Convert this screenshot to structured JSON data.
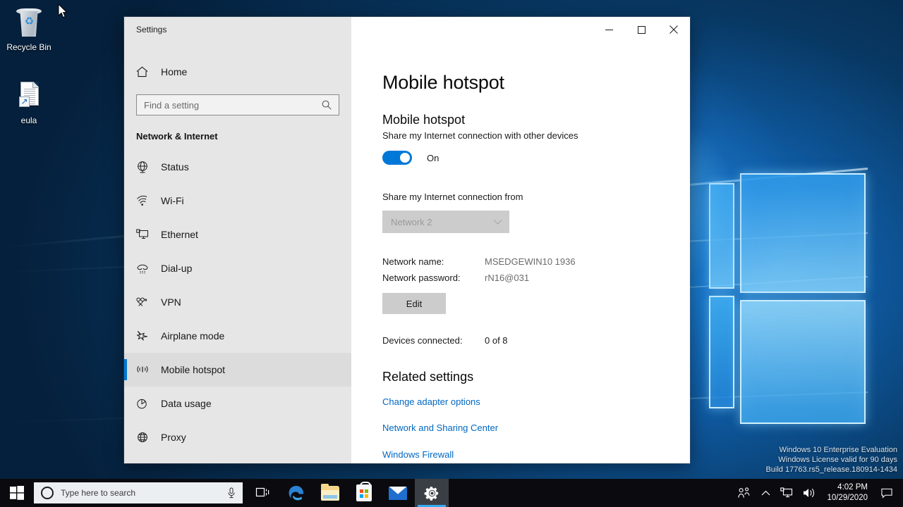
{
  "desktop": {
    "icons": [
      {
        "name": "Recycle Bin",
        "icon": "recycle-bin-icon"
      },
      {
        "name": "eula",
        "icon": "text-document-shortcut-icon"
      }
    ],
    "watermark": {
      "line1": "Windows 10 Enterprise Evaluation",
      "line2": "Windows License valid for 90 days",
      "line3": "Build 17763.rs5_release.180914-1434"
    }
  },
  "window": {
    "title": "Settings",
    "controls": {
      "minimize": "Minimize",
      "maximize": "Maximize",
      "close": "Close"
    }
  },
  "sidebar": {
    "home_label": "Home",
    "search": {
      "placeholder": "Find a setting",
      "value": ""
    },
    "group_title": "Network & Internet",
    "items": [
      {
        "label": "Status",
        "icon": "globe-status-icon",
        "selected": false
      },
      {
        "label": "Wi-Fi",
        "icon": "wifi-icon",
        "selected": false
      },
      {
        "label": "Ethernet",
        "icon": "ethernet-icon",
        "selected": false
      },
      {
        "label": "Dial-up",
        "icon": "dialup-phone-icon",
        "selected": false
      },
      {
        "label": "VPN",
        "icon": "vpn-icon",
        "selected": false
      },
      {
        "label": "Airplane mode",
        "icon": "airplane-icon",
        "selected": false
      },
      {
        "label": "Mobile hotspot",
        "icon": "mobile-hotspot-icon",
        "selected": true
      },
      {
        "label": "Data usage",
        "icon": "pie-chart-icon",
        "selected": false
      },
      {
        "label": "Proxy",
        "icon": "globe-proxy-icon",
        "selected": false
      }
    ]
  },
  "content": {
    "page_title": "Mobile hotspot",
    "section_heading": "Mobile hotspot",
    "section_subtitle": "Share my Internet connection with other devices",
    "toggle": {
      "state_label": "On",
      "on": true
    },
    "share_from": {
      "label": "Share my Internet connection from",
      "selected_option": "Network 2",
      "disabled": true
    },
    "details": [
      {
        "key": "Network name:",
        "value": "MSEDGEWIN10 1936"
      },
      {
        "key": "Network password:",
        "value": "rN16@031"
      }
    ],
    "edit_button": "Edit",
    "devices": {
      "key": "Devices connected:",
      "value": "0 of 8"
    },
    "related": {
      "heading": "Related settings",
      "links": [
        "Change adapter options",
        "Network and Sharing Center",
        "Windows Firewall"
      ]
    }
  },
  "taskbar": {
    "start": "Start",
    "search_placeholder": "Type here to search",
    "apps": [
      {
        "name": "Task View",
        "icon": "task-view-icon",
        "active": false
      },
      {
        "name": "Microsoft Edge",
        "icon": "edge-icon",
        "active": false
      },
      {
        "name": "File Explorer",
        "icon": "file-explorer-icon",
        "active": false
      },
      {
        "name": "Microsoft Store",
        "icon": "microsoft-store-icon",
        "active": false
      },
      {
        "name": "Mail",
        "icon": "mail-icon",
        "active": false
      },
      {
        "name": "Settings",
        "icon": "settings-gear-icon",
        "active": true
      }
    ],
    "tray": {
      "people": "People",
      "show_hidden": "Show hidden icons",
      "network": "Network",
      "volume": "Volume",
      "time": "4:02 PM",
      "date": "10/29/2020",
      "action_center": "Action Center"
    }
  },
  "colors": {
    "accent": "#0078d7",
    "link": "#0067c0",
    "sidebar_bg": "#e6e6e6",
    "taskbar_bg": "#0b0b0f"
  }
}
